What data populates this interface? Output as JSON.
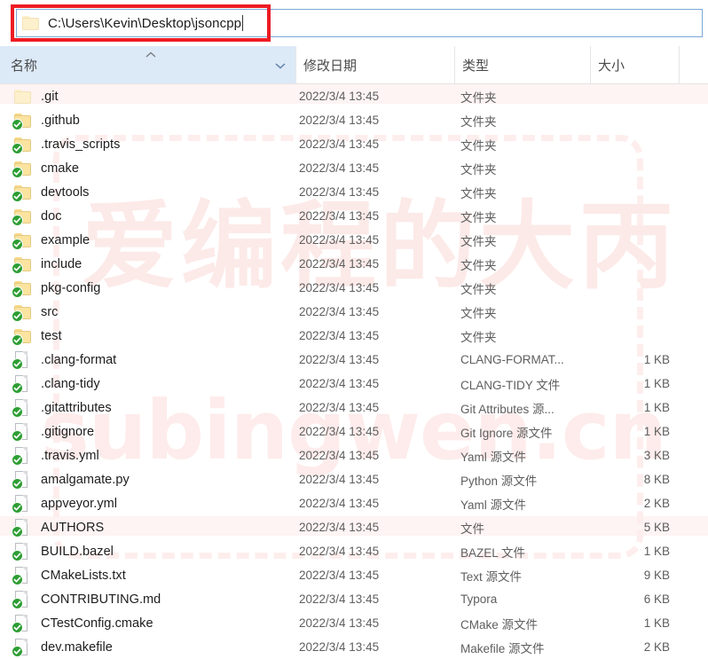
{
  "window": {
    "address_bar": {
      "path": "C:\\Users\\Kevin\\Desktop\\jsoncpp",
      "placeholder": "C:\\Users\\Kevin\\Desktop\\jsoncpp",
      "folder_icon": "folder-icon",
      "highlight_color": "#ed1c24"
    }
  },
  "columns": {
    "name": "名称",
    "date_modified": "修改日期",
    "type": "类型",
    "size": "大小",
    "sort_caret_icon": "chevron-up-icon",
    "dropdown_icon": "chevron-down-icon",
    "sorted_by": "名称",
    "sort_direction": "ascending"
  },
  "watermark": {
    "main": "爱编程的大丙",
    "sub": "subingwen.cn",
    "color": "#fceae8"
  },
  "files": [
    {
      "name": ".git",
      "date": "2022/3/4 13:45",
      "type": "文件夹",
      "size": "",
      "kind": "folder",
      "synced": false
    },
    {
      "name": ".github",
      "date": "2022/3/4 13:45",
      "type": "文件夹",
      "size": "",
      "kind": "folder",
      "synced": true
    },
    {
      "name": ".travis_scripts",
      "date": "2022/3/4 13:45",
      "type": "文件夹",
      "size": "",
      "kind": "folder",
      "synced": true
    },
    {
      "name": "cmake",
      "date": "2022/3/4 13:45",
      "type": "文件夹",
      "size": "",
      "kind": "folder",
      "synced": true
    },
    {
      "name": "devtools",
      "date": "2022/3/4 13:45",
      "type": "文件夹",
      "size": "",
      "kind": "folder",
      "synced": true
    },
    {
      "name": "doc",
      "date": "2022/3/4 13:45",
      "type": "文件夹",
      "size": "",
      "kind": "folder",
      "synced": true
    },
    {
      "name": "example",
      "date": "2022/3/4 13:45",
      "type": "文件夹",
      "size": "",
      "kind": "folder",
      "synced": true
    },
    {
      "name": "include",
      "date": "2022/3/4 13:45",
      "type": "文件夹",
      "size": "",
      "kind": "folder",
      "synced": true
    },
    {
      "name": "pkg-config",
      "date": "2022/3/4 13:45",
      "type": "文件夹",
      "size": "",
      "kind": "folder",
      "synced": true
    },
    {
      "name": "src",
      "date": "2022/3/4 13:45",
      "type": "文件夹",
      "size": "",
      "kind": "folder",
      "synced": true
    },
    {
      "name": "test",
      "date": "2022/3/4 13:45",
      "type": "文件夹",
      "size": "",
      "kind": "folder",
      "synced": true
    },
    {
      "name": ".clang-format",
      "date": "2022/3/4 13:45",
      "type": "CLANG-FORMAT...",
      "size": "1 KB",
      "kind": "file",
      "synced": true
    },
    {
      "name": ".clang-tidy",
      "date": "2022/3/4 13:45",
      "type": "CLANG-TIDY 文件",
      "size": "1 KB",
      "kind": "file",
      "synced": true
    },
    {
      "name": ".gitattributes",
      "date": "2022/3/4 13:45",
      "type": "Git Attributes 源...",
      "size": "1 KB",
      "kind": "file",
      "synced": true
    },
    {
      "name": ".gitignore",
      "date": "2022/3/4 13:45",
      "type": "Git Ignore 源文件",
      "size": "1 KB",
      "kind": "file",
      "synced": true
    },
    {
      "name": ".travis.yml",
      "date": "2022/3/4 13:45",
      "type": "Yaml 源文件",
      "size": "3 KB",
      "kind": "file",
      "synced": true
    },
    {
      "name": "amalgamate.py",
      "date": "2022/3/4 13:45",
      "type": "Python 源文件",
      "size": "8 KB",
      "kind": "file",
      "synced": true
    },
    {
      "name": "appveyor.yml",
      "date": "2022/3/4 13:45",
      "type": "Yaml 源文件",
      "size": "2 KB",
      "kind": "file",
      "synced": true
    },
    {
      "name": "AUTHORS",
      "date": "2022/3/4 13:45",
      "type": "文件",
      "size": "5 KB",
      "kind": "file",
      "synced": true
    },
    {
      "name": "BUILD.bazel",
      "date": "2022/3/4 13:45",
      "type": "BAZEL 文件",
      "size": "1 KB",
      "kind": "file",
      "synced": true
    },
    {
      "name": "CMakeLists.txt",
      "date": "2022/3/4 13:45",
      "type": "Text 源文件",
      "size": "9 KB",
      "kind": "file",
      "synced": true
    },
    {
      "name": "CONTRIBUTING.md",
      "date": "2022/3/4 13:45",
      "type": "Typora",
      "size": "6 KB",
      "kind": "file",
      "synced": true
    },
    {
      "name": "CTestConfig.cmake",
      "date": "2022/3/4 13:45",
      "type": "CMake 源文件",
      "size": "1 KB",
      "kind": "file",
      "synced": true
    },
    {
      "name": "dev.makefile",
      "date": "2022/3/4 13:45",
      "type": "Makefile 源文件",
      "size": "2 KB",
      "kind": "file",
      "synced": true
    }
  ]
}
